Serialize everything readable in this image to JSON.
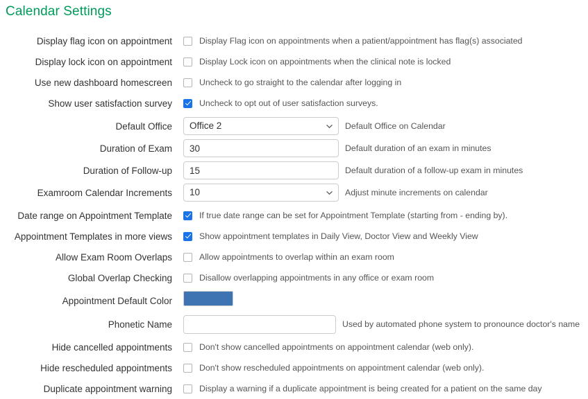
{
  "page": {
    "title": "Calendar Settings",
    "title_color": "#009a5b"
  },
  "theme": {
    "checkbox_checked_color": "#1a73e8",
    "field_border_color": "#ccccce",
    "hint_text_color": "#555555",
    "label_text_color": "#333333",
    "background": "#ffffff"
  },
  "settings": {
    "display_flag_icon": {
      "label": "Display flag icon on appointment",
      "hint": "Display Flag icon on appointments when a patient/appointment has flag(s) associated",
      "checked": false
    },
    "display_lock_icon": {
      "label": "Display lock icon on appointment",
      "hint": "Display Lock icon on appointments when the clinical note is locked",
      "checked": false
    },
    "new_dashboard_homescreen": {
      "label": "Use new dashboard homescreen",
      "hint": "Uncheck to go straight to the calendar after logging in",
      "checked": false
    },
    "user_satisfaction_survey": {
      "label": "Show user satisfaction survey",
      "hint": "Uncheck to opt out of user satisfaction surveys.",
      "checked": true
    },
    "default_office": {
      "label": "Default Office",
      "value": "Office 2",
      "hint": "Default Office on Calendar",
      "options": [
        "Office 2"
      ]
    },
    "duration_of_exam": {
      "label": "Duration of Exam",
      "value": "30",
      "hint": "Default duration of an exam in minutes"
    },
    "duration_of_followup": {
      "label": "Duration of Follow-up",
      "value": "15",
      "hint": "Default duration of a follow-up exam in minutes"
    },
    "examroom_calendar_increments": {
      "label": "Examroom Calendar Increments",
      "value": "10",
      "hint": "Adjust minute increments on calendar",
      "options": [
        "10"
      ]
    },
    "date_range_appointment_template": {
      "label": "Date range on Appointment Template",
      "hint": "If true date range can be set for Appointment Template (starting from - ending by).",
      "checked": true
    },
    "appointment_templates_more_views": {
      "label": "Appointment Templates in more views",
      "hint": "Show appointment templates in Daily View, Doctor View and Weekly View",
      "checked": true
    },
    "allow_exam_room_overlaps": {
      "label": "Allow Exam Room Overlaps",
      "hint": "Allow appointments to overlap within an exam room",
      "checked": false
    },
    "global_overlap_checking": {
      "label": "Global Overlap Checking",
      "hint": "Disallow overlapping appointments in any office or exam room",
      "checked": false
    },
    "appointment_default_color": {
      "label": "Appointment Default Color",
      "value": "#3f74b2"
    },
    "phonetic_name": {
      "label": "Phonetic Name",
      "value": "",
      "placeholder": "",
      "hint": "Used by automated phone system to pronounce doctor's name"
    },
    "hide_cancelled_appointments": {
      "label": "Hide cancelled appointments",
      "hint": "Don't show cancelled appointments on appointment calendar (web only).",
      "checked": false
    },
    "hide_rescheduled_appointments": {
      "label": "Hide rescheduled appointments",
      "hint": "Don't show rescheduled appointments on appointment calendar (web only).",
      "checked": false
    },
    "duplicate_appointment_warning": {
      "label": "Duplicate appointment warning",
      "hint": "Display a warning if a duplicate appointment is being created for a patient on the same day",
      "checked": false
    }
  }
}
